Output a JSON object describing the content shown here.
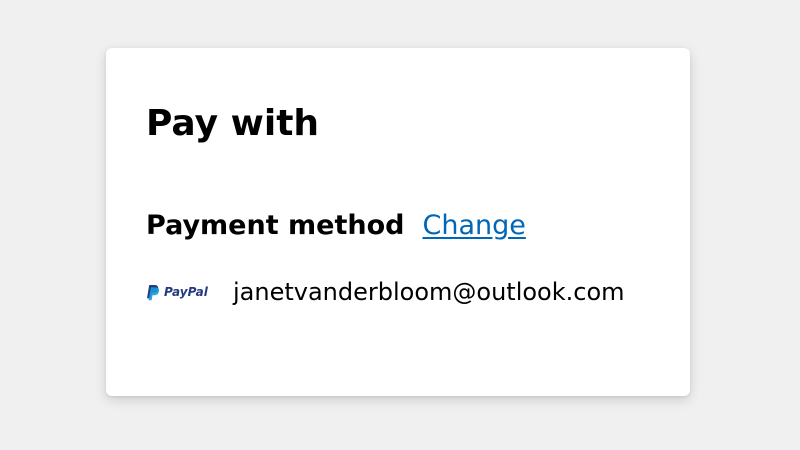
{
  "payment": {
    "title": "Pay with",
    "method_label": "Payment method",
    "change_link": "Change",
    "provider": {
      "name": "PayPal",
      "icon": "paypal-logo-icon",
      "account": "janetvanderbloom@outlook.com"
    }
  },
  "colors": {
    "background": "#f0f0f0",
    "card": "#ffffff",
    "link": "#0067b8",
    "paypal_dark_blue": "#253b80",
    "paypal_light_blue": "#179bd7"
  }
}
